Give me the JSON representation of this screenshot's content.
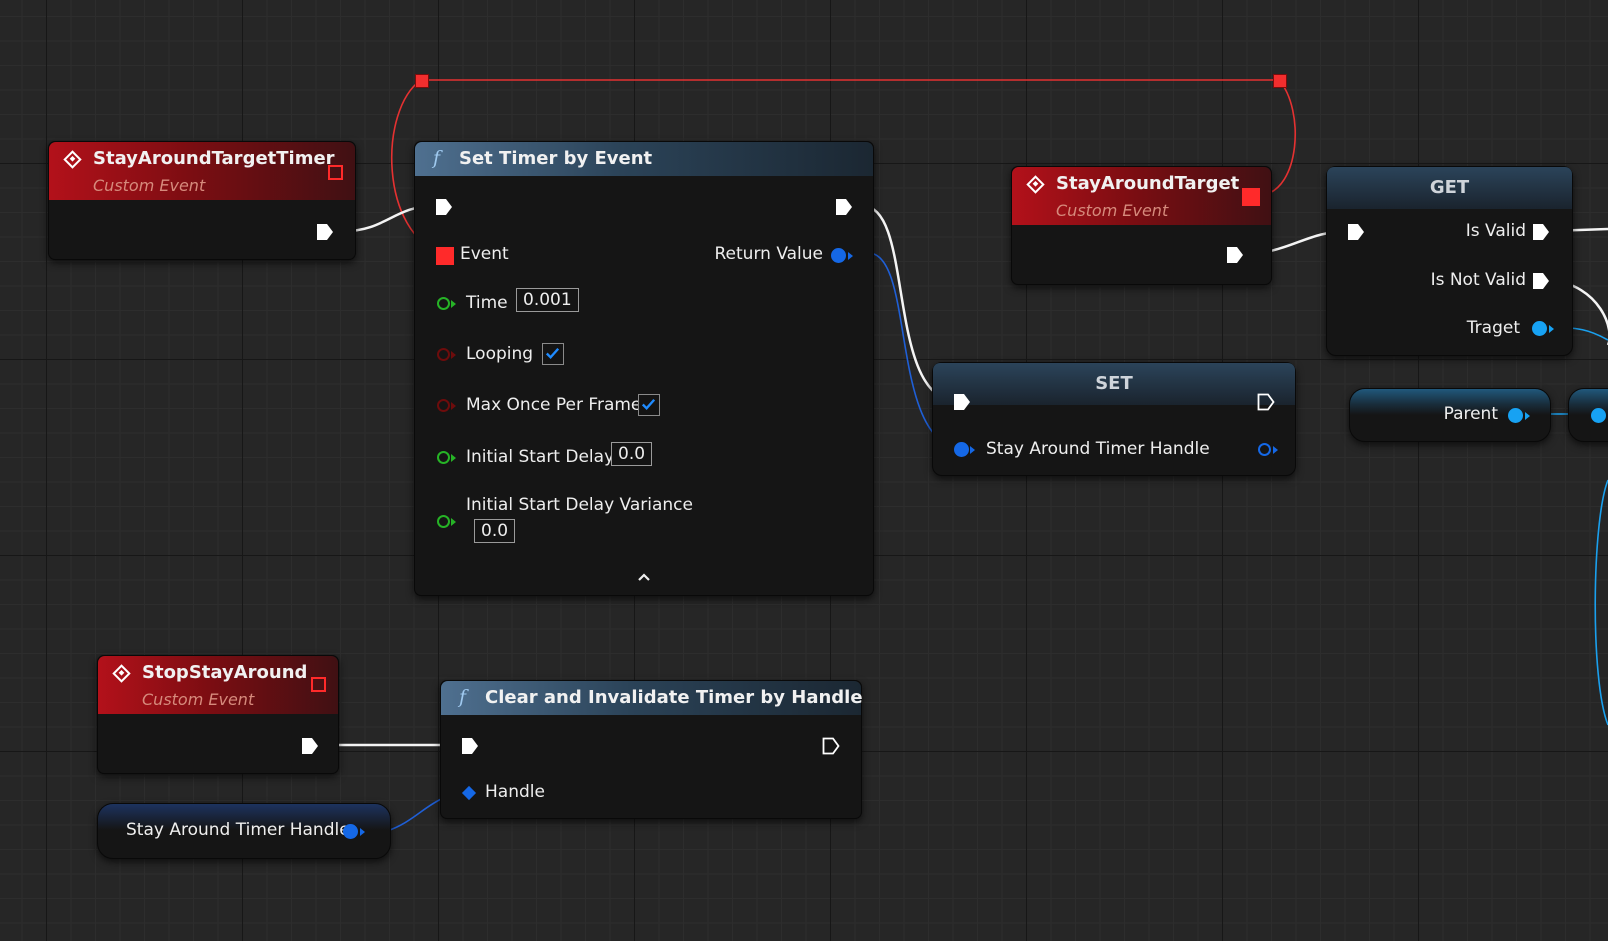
{
  "colors": {
    "exec": "#ffffff",
    "delegate": "#ff2a2a",
    "float": "#26b326",
    "bool": "#6d0c0c",
    "timer_handle": "#1568e6",
    "object": "#17a2f3"
  },
  "nodes": {
    "stay_around_target_timer": {
      "title": "StayAroundTargetTimer",
      "subtitle": "Custom Event"
    },
    "set_timer": {
      "title": "Set Timer by Event",
      "icon": "function-icon",
      "event_label": "Event",
      "return_label": "Return Value",
      "time_label": "Time",
      "time_value": "0.001",
      "looping_label": "Looping",
      "looping_checked": true,
      "max_once_label": "Max Once Per Frame",
      "max_once_checked": true,
      "initial_delay_label": "Initial Start Delay",
      "initial_delay_value": "0.0",
      "delay_variance_label": "Initial Start Delay Variance",
      "delay_variance_value": "0.0"
    },
    "stay_around_target": {
      "title": "StayAroundTarget",
      "subtitle": "Custom Event"
    },
    "get": {
      "title": "GET",
      "is_valid": "Is Valid",
      "is_not_valid": "Is Not Valid",
      "target": "Traget"
    },
    "set": {
      "title": "SET",
      "var_label": "Stay Around Timer Handle"
    },
    "parent": {
      "label": "Parent"
    },
    "stop_stay_around": {
      "title": "StopStayAround",
      "subtitle": "Custom Event"
    },
    "clear_timer": {
      "title": "Clear and Invalidate Timer by Handle",
      "handle_label": "Handle"
    },
    "timer_handle_var": {
      "label": "Stay Around Timer Handle"
    }
  }
}
